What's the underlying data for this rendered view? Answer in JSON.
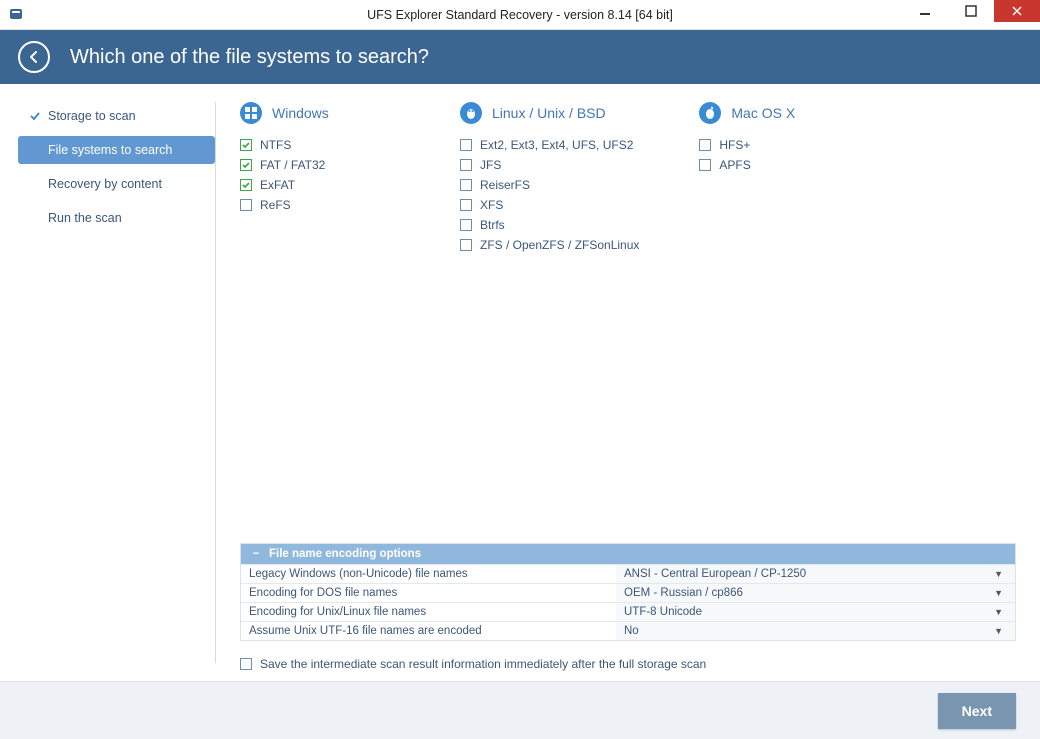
{
  "window": {
    "title": "UFS Explorer Standard Recovery - version 8.14 [64 bit]"
  },
  "banner": {
    "heading": "Which one of the file systems to search?"
  },
  "steps": [
    {
      "label": "Storage to scan",
      "done": true,
      "active": false
    },
    {
      "label": "File systems to search",
      "done": false,
      "active": true
    },
    {
      "label": "Recovery by content",
      "done": false,
      "active": false
    },
    {
      "label": "Run the scan",
      "done": false,
      "active": false
    }
  ],
  "fs_groups": [
    {
      "title": "Windows",
      "icon": "windows",
      "items": [
        {
          "label": "NTFS",
          "checked": true
        },
        {
          "label": "FAT / FAT32",
          "checked": true
        },
        {
          "label": "ExFAT",
          "checked": true
        },
        {
          "label": "ReFS",
          "checked": false
        }
      ]
    },
    {
      "title": "Linux / Unix / BSD",
      "icon": "linux",
      "items": [
        {
          "label": "Ext2, Ext3, Ext4, UFS, UFS2",
          "checked": false
        },
        {
          "label": "JFS",
          "checked": false
        },
        {
          "label": "ReiserFS",
          "checked": false
        },
        {
          "label": "XFS",
          "checked": false
        },
        {
          "label": "Btrfs",
          "checked": false
        },
        {
          "label": "ZFS / OpenZFS / ZFSonLinux",
          "checked": false
        }
      ]
    },
    {
      "title": "Mac OS X",
      "icon": "apple",
      "items": [
        {
          "label": "HFS+",
          "checked": false
        },
        {
          "label": "APFS",
          "checked": false
        }
      ]
    }
  ],
  "encoding": {
    "header": "File name encoding options",
    "rows": [
      {
        "label": "Legacy Windows (non-Unicode) file names",
        "value": "ANSI - Central European / CP-1250"
      },
      {
        "label": "Encoding for DOS file names",
        "value": "OEM - Russian / cp866"
      },
      {
        "label": "Encoding for Unix/Linux file names",
        "value": "UTF-8 Unicode"
      },
      {
        "label": "Assume Unix UTF-16 file names are encoded",
        "value": "No"
      }
    ]
  },
  "save_intermediate": {
    "label": "Save the intermediate scan result information immediately after the full storage scan",
    "checked": false
  },
  "footer": {
    "next": "Next"
  }
}
